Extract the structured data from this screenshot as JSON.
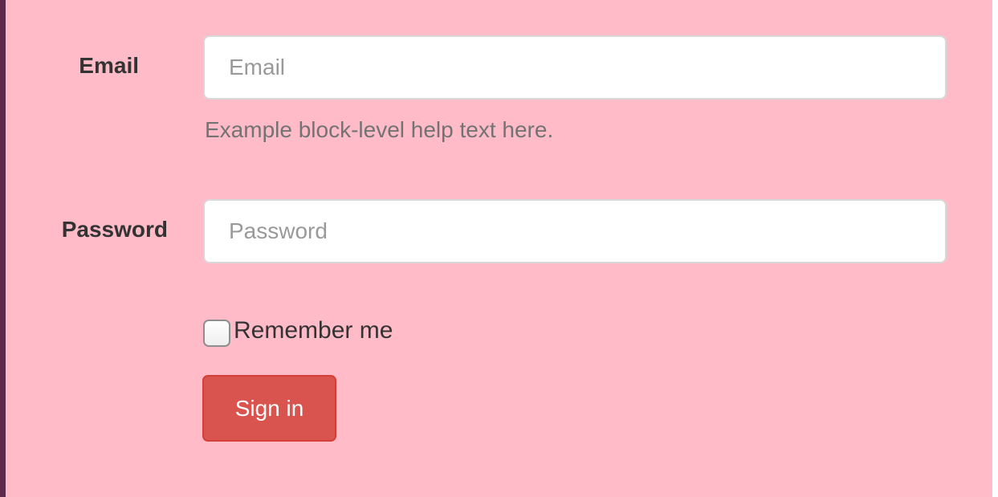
{
  "form": {
    "email_label": "Email",
    "email_placeholder": "Email",
    "email_value": "",
    "help_text": "Example block-level help text here.",
    "password_label": "Password",
    "password_placeholder": "Password",
    "password_value": "",
    "remember_label": "Remember me",
    "remember_checked": false,
    "submit_label": "Sign in"
  },
  "colors": {
    "background": "#ffbcc8",
    "left_border": "#5e2a4e",
    "button": "#d9534f"
  }
}
